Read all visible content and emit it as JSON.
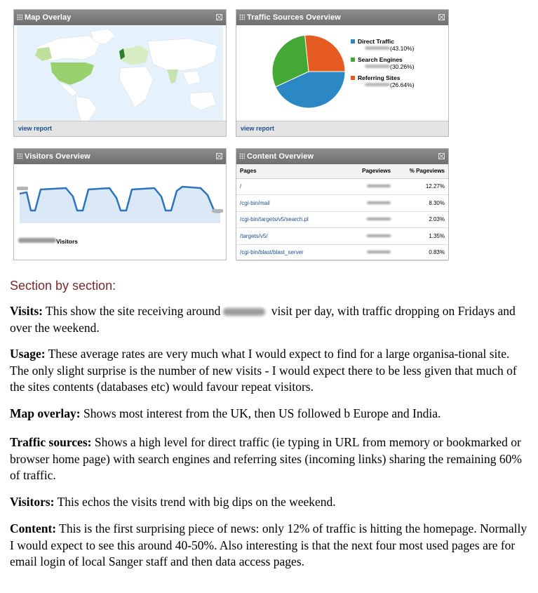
{
  "widgets": {
    "map": {
      "title": "Map Overlay",
      "link": "view report",
      "colors": {
        "ocean": "#e6f2fb",
        "land": "#ffffff",
        "uk": "#2f7d2a",
        "us": "#9bd06e",
        "eu": "#d8ecc4",
        "india": "#c7e3ad"
      }
    },
    "traffic": {
      "title": "Traffic Sources Overview",
      "link": "view report",
      "legend": [
        {
          "name": "Direct Traffic",
          "pct": "(43.10%)",
          "color": "#2b88c5"
        },
        {
          "name": "Search Engines",
          "pct": "(30.26%)",
          "color": "#43a934"
        },
        {
          "name": "Referring Sites",
          "pct": "(26.64%)",
          "color": "#e55b21"
        }
      ]
    },
    "visitors": {
      "title": "Visitors Overview",
      "label": "Visitors",
      "line_color": "#2c73c0",
      "fill_color": "#dbe8f6"
    },
    "content": {
      "title": "Content Overview",
      "columns": [
        "Pages",
        "Pageviews",
        "% Pageviews"
      ],
      "rows": [
        {
          "page": "/",
          "pct": "12.27%"
        },
        {
          "page": "/cgi-bin/mail",
          "pct": "8.30%"
        },
        {
          "page": "/cgi-bin/targets/v5/search.pl",
          "pct": "2.03%"
        },
        {
          "page": "/targets/v5/",
          "pct": "1.35%"
        },
        {
          "page": "/cgi-bin/blast/blast_server",
          "pct": "0.83%"
        }
      ]
    }
  },
  "section_title": "Section by section:",
  "paragraphs": {
    "visits": {
      "label": "Visits:",
      "before": " This show the site receiving around",
      "after": " visit per day, with traffic dropping on Fridays and over the weekend."
    },
    "usage": {
      "label": "Usage:",
      "text": " These average rates are very much what I would expect to find for a large organisa-tional site. The only slight surprise is the number of new visits - I would expect there to be less given that much of the sites contents (databases etc) would favour repeat visitors."
    },
    "map": {
      "label": "Map overlay:",
      "text": " Shows most interest from the UK, then US followed b Europe and India."
    },
    "traffic": {
      "label": "Traffic sources:",
      "text": " Shows a high level for direct traffic (ie typing in URL from memory or bookmarked or browser home page) with search engines and referring sites (incoming links) sharing the remaining 60% of traffic."
    },
    "visitors": {
      "label": "Visitors:",
      "text": " This echos the visits trend with big dips on the weekend."
    },
    "content": {
      "label": "Content:",
      "text": " This is the first surprising piece of news: only 12% of traffic is hitting the homepage. Normally I would expect to see this around 40-50%. Also interesting is that the next four most used pages are for email login of local Sanger staff and then data access pages."
    }
  }
}
